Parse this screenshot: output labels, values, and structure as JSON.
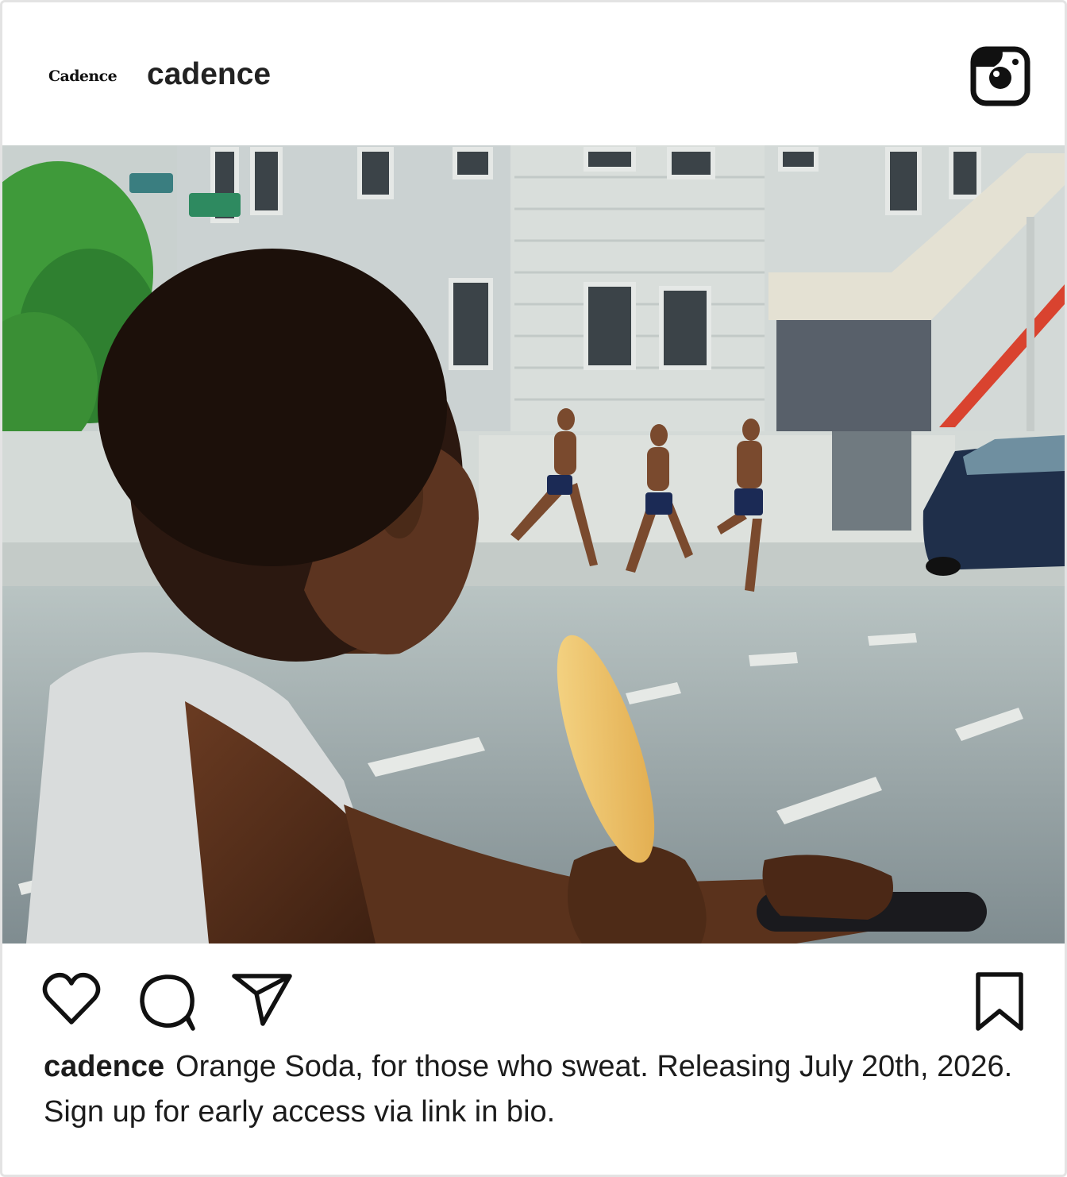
{
  "post": {
    "brand_logo_text": "Cadence",
    "username": "cadence",
    "platform_icon": "instagram-icon",
    "image_alt": "Boy holding a popsicle watching runners across a sunny street",
    "actions": {
      "like_icon": "heart-icon",
      "comment_icon": "speech-bubble-icon",
      "share_icon": "paper-plane-icon",
      "save_icon": "bookmark-icon"
    },
    "caption": {
      "username": "cadence",
      "text": "Orange Soda, for those who sweat. Releasing July 20th, 2026. Sign up for early access via link in bio."
    }
  }
}
